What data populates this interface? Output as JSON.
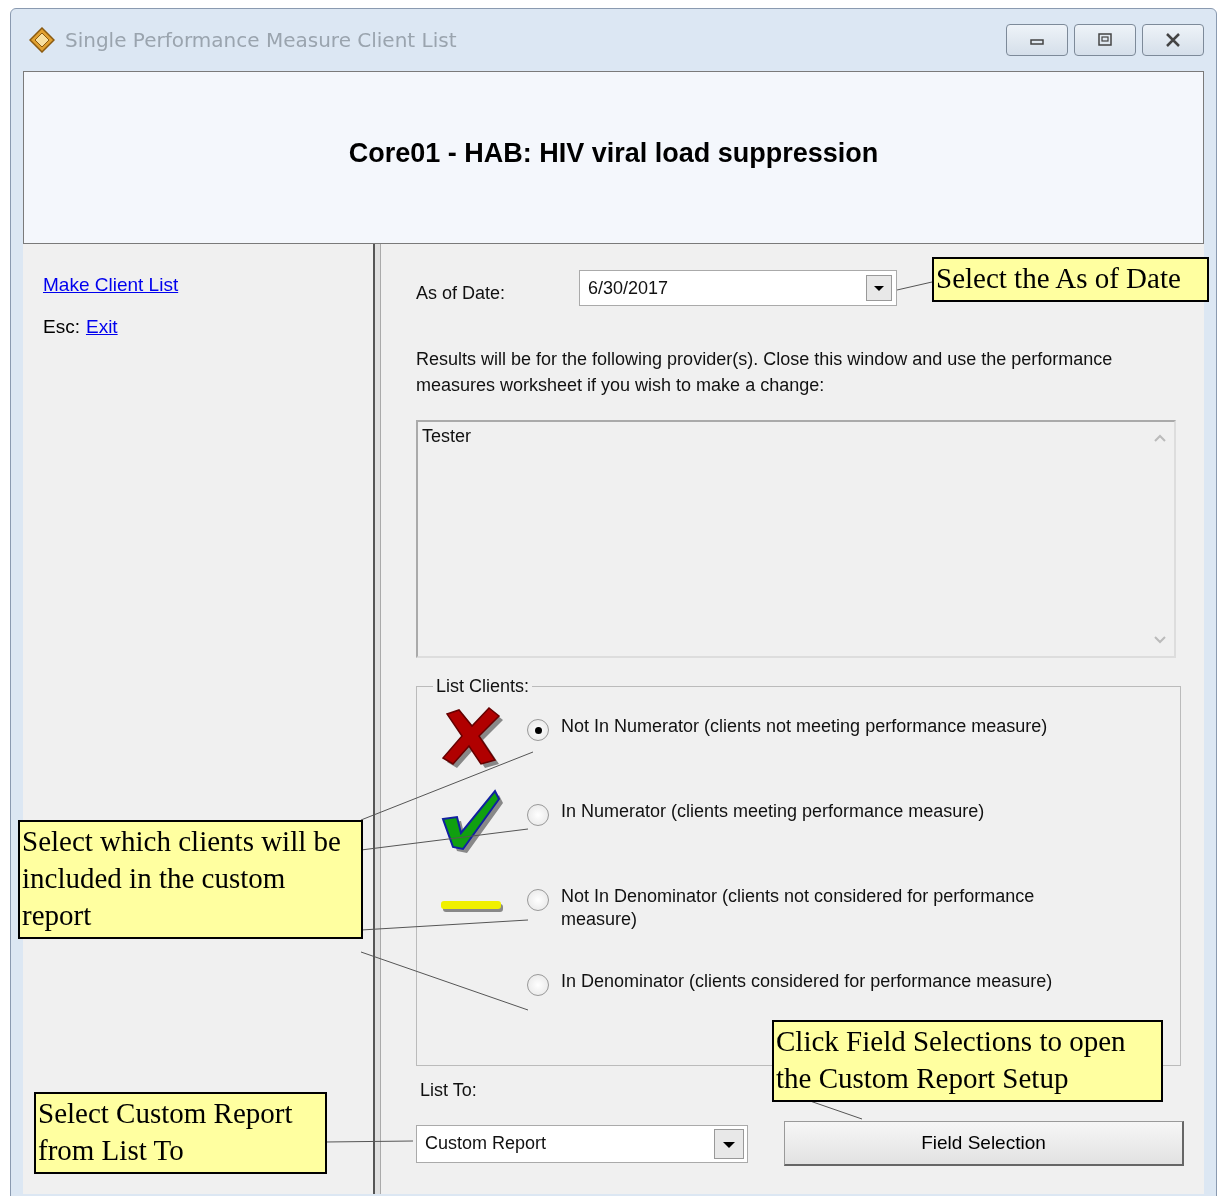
{
  "window": {
    "title": "Single Performance Measure Client List"
  },
  "header": {
    "title": "Core01 - HAB: HIV viral load suppression"
  },
  "sidebar": {
    "items": [
      {
        "link": "Make Client List"
      },
      {
        "key": "Esc:",
        "link": "Exit"
      }
    ]
  },
  "as_of_date": {
    "label": "As of Date:",
    "value": "6/30/2017"
  },
  "providers": {
    "description": "Results will be for the following provider(s). Close this window and use the performance measures worksheet if you wish to make a change:",
    "items": [
      "Tester"
    ]
  },
  "list_clients": {
    "legend": "List Clients:",
    "options": [
      {
        "kind": "cross",
        "label": "Not In Numerator (clients not meeting performance measure)",
        "selected": true
      },
      {
        "kind": "check",
        "label": "In Numerator (clients meeting performance measure)",
        "selected": false
      },
      {
        "kind": "dash",
        "label": "Not In Denominator (clients not considered for performance measure)",
        "selected": false
      },
      {
        "kind": "plain",
        "label": "In Denominator (clients considered for performance measure)",
        "selected": false
      }
    ]
  },
  "list_to": {
    "label": "List To:",
    "value": "Custom Report"
  },
  "field_selection_button": "Field Selection",
  "callouts": [
    {
      "text": "Select the As of Date"
    },
    {
      "text": "Select which clients will be included in the custom report"
    },
    {
      "text": "Click Field Selections to open the Custom Report Setup"
    },
    {
      "text": "Select Custom Report from List To"
    }
  ]
}
